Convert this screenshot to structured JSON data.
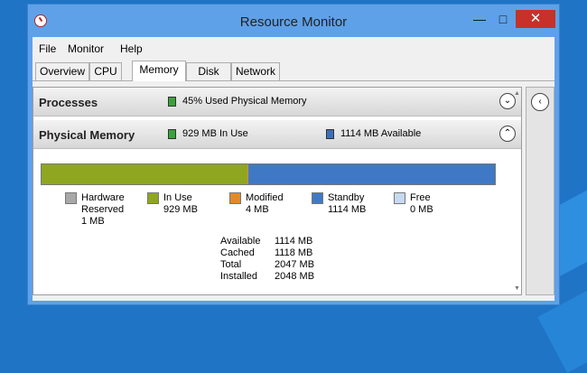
{
  "window": {
    "title": "Resource Monitor",
    "close_glyph": "✕",
    "minimize_glyph": "—",
    "maximize_glyph": "□"
  },
  "menu": [
    "File",
    "Monitor",
    "Help"
  ],
  "tabs": [
    {
      "label": "Overview",
      "active": false
    },
    {
      "label": "CPU",
      "active": false
    },
    {
      "label": "Memory",
      "active": true
    },
    {
      "label": "Disk",
      "active": false
    },
    {
      "label": "Network",
      "active": false
    }
  ],
  "processes": {
    "title": "Processes",
    "summary": "45% Used Physical Memory",
    "summary_color": "#37a43a",
    "toggle_icon": "chevron-down-icon",
    "toggle_glyph": "⌄"
  },
  "physical_memory": {
    "title": "Physical Memory",
    "in_use_summary": "929 MB In Use",
    "available_summary": "1114 MB Available",
    "in_use_color": "#37a43a",
    "available_color": "#3c6fbb",
    "toggle_icon": "chevron-up-icon",
    "toggle_glyph": "⌃",
    "bar": {
      "in_use_mb": 929,
      "modified_mb": 4,
      "standby_mb": 1114,
      "free_mb": 0,
      "reserved_mb": 1,
      "colors": {
        "in_use": "#8fa621",
        "modified": "#e08a2c",
        "standby": "#3f79c6",
        "free": "#c6d9f1",
        "reserved": "#a8a8a8"
      }
    },
    "legend": [
      {
        "name": "Hardware",
        "line2": "Reserved",
        "value": "1 MB",
        "color": "#a8a8a8"
      },
      {
        "name": "In Use",
        "line2": "",
        "value": "929 MB",
        "color": "#8fa621"
      },
      {
        "name": "Modified",
        "line2": "",
        "value": "4 MB",
        "color": "#e08a2c"
      },
      {
        "name": "Standby",
        "line2": "",
        "value": "1114 MB",
        "color": "#3f79c6"
      },
      {
        "name": "Free",
        "line2": "",
        "value": "0 MB",
        "color": "#c6d9f1"
      }
    ],
    "stats": [
      {
        "label": "Available",
        "value": "1114 MB"
      },
      {
        "label": "Cached",
        "value": "1118 MB"
      },
      {
        "label": "Total",
        "value": "2047 MB"
      },
      {
        "label": "Installed",
        "value": "2048 MB"
      }
    ]
  },
  "side_panel": {
    "toggle_icon": "chevron-left-icon",
    "toggle_glyph": "‹"
  }
}
